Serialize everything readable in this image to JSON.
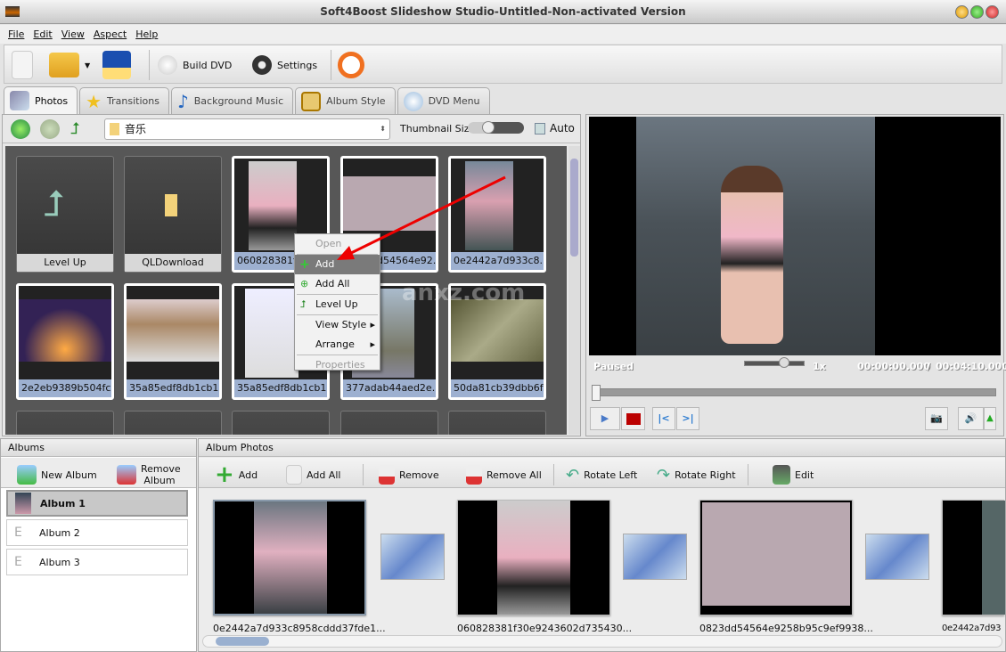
{
  "window": {
    "title": "Soft4Boost Slideshow Studio-Untitled-Non-activated Version"
  },
  "menu": [
    "File",
    "Edit",
    "View",
    "Aspect",
    "Help"
  ],
  "toolbar": {
    "build_dvd": "Build DVD",
    "settings": "Settings"
  },
  "tabs": [
    "Photos",
    "Transitions",
    "Background Music",
    "Album Style",
    "DVD Menu"
  ],
  "browser": {
    "path": "音乐",
    "thumbnail_size_label": "Thumbnail Size:",
    "auto_label": "Auto",
    "auto_checked": false,
    "thumbnail_size": 0.35,
    "items": [
      {
        "label": "Level Up",
        "type": "folder"
      },
      {
        "label": "QLDownload",
        "type": "folder"
      },
      {
        "label": "060828381f3...",
        "type": "photo"
      },
      {
        "label": "0823dd54564e92...",
        "type": "photo"
      },
      {
        "label": "0e2442a7d933c8...",
        "type": "photo"
      },
      {
        "label": "2e2eb9389b504fc...",
        "type": "photo"
      },
      {
        "label": "35a85edf8db1cb1...",
        "type": "photo"
      },
      {
        "label": "35a85edf8db1cb1...",
        "type": "photo"
      },
      {
        "label": "377adab44aed2e...",
        "type": "photo"
      },
      {
        "label": "50da81cb39dbb6f...",
        "type": "photo"
      }
    ]
  },
  "context_menu": [
    {
      "label": "Open",
      "disabled": true
    },
    {
      "label": "Add",
      "selected": true
    },
    {
      "label": "Add All"
    },
    {
      "label": "Level Up"
    },
    {
      "label": "View Style",
      "submenu": true
    },
    {
      "label": "Arrange",
      "submenu": true
    },
    {
      "label": "Properties",
      "disabled": true
    }
  ],
  "player": {
    "status": "Paused",
    "speed": "1x",
    "current_time": "00:00:00.000",
    "separator": "/",
    "total_time": "00:04:10.000",
    "progress": 0
  },
  "albums": {
    "header": "Albums",
    "new_album": "New Album",
    "remove_album": "Remove Album",
    "items": [
      "Album 1",
      "Album 2",
      "Album 3"
    ],
    "selected": 0
  },
  "album_photos": {
    "header": "Album Photos",
    "buttons": [
      "Add",
      "Add All",
      "Remove",
      "Remove All",
      "Rotate Left",
      "Rotate Right",
      "Edit"
    ],
    "items": [
      "0e2442a7d933c8958cddd37fde1...",
      "060828381f30e9243602d735430...",
      "0823dd54564e9258b95c9ef9938...",
      "0e2442a7d93"
    ]
  },
  "watermark": "anxz.com"
}
